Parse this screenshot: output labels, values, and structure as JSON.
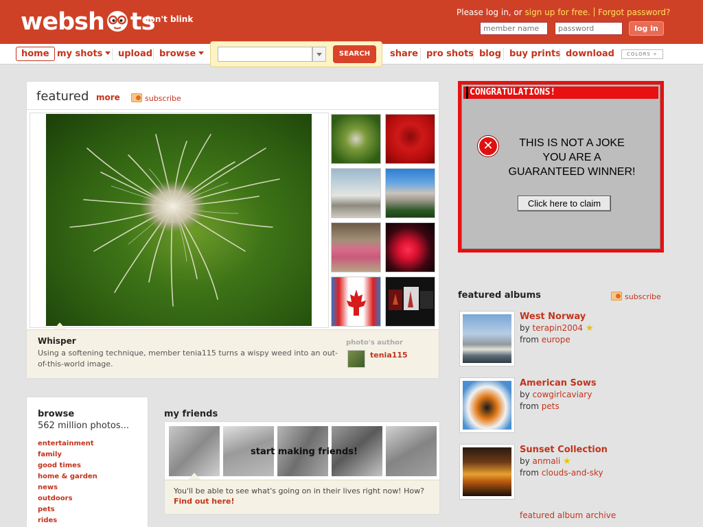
{
  "header": {
    "logo_left": "websh",
    "logo_right": "ts",
    "tagline": "don't blink",
    "login_prefix": "Please log in, or ",
    "signup_link": "sign up for free.",
    "forgot_link": "Forgot password?",
    "member_placeholder": "member name",
    "password_placeholder": "password",
    "login_button": "log in"
  },
  "nav": {
    "home": "home",
    "my_shots": "my shots",
    "upload": "upload",
    "browse": "browse",
    "search_button": "SEARCH",
    "share": "share",
    "pro_shots": "pro shots",
    "blog": "blog",
    "buy_prints": "buy prints",
    "download": "download",
    "colors": "COLORS ÷"
  },
  "featured": {
    "title": "featured",
    "more": "more",
    "subscribe": "subscribe",
    "photo_title": "Whisper",
    "photo_desc": "Using a softening technique, member tenia115 turns a wispy weed into an out-of-this-world image.",
    "author_label": "photo's author",
    "author_name": "tenia115"
  },
  "ad": {
    "header": "CONGRATULATIONS!",
    "line1": "THIS IS NOT A JOKE",
    "line2": "YOU ARE A",
    "line3": "GUARANTEED WINNER!",
    "button": "Click here to claim"
  },
  "featured_albums": {
    "title": "featured albums",
    "subscribe": "subscribe",
    "archive": "featured album archive",
    "albums": [
      {
        "name": "West Norway",
        "by_label": "by ",
        "user": "terapin2004",
        "from_label": "from ",
        "category": "europe"
      },
      {
        "name": "American Sows",
        "by_label": "by ",
        "user": "cowgirlcaviary",
        "from_label": "from ",
        "category": "pets"
      },
      {
        "name": "Sunset Collection",
        "by_label": "by ",
        "user": "anmali",
        "from_label": "from ",
        "category": "clouds-and-sky"
      }
    ]
  },
  "browse": {
    "title": "browse",
    "count": "562 million photos...",
    "categories": [
      "entertainment",
      "family",
      "good times",
      "home & garden",
      "news",
      "outdoors",
      "pets",
      "rides"
    ]
  },
  "friends": {
    "title": "my friends",
    "message": "start making friends!",
    "caption": "You'll be able to see what's going on in their lives right now! How?",
    "link": "Find out here!"
  }
}
